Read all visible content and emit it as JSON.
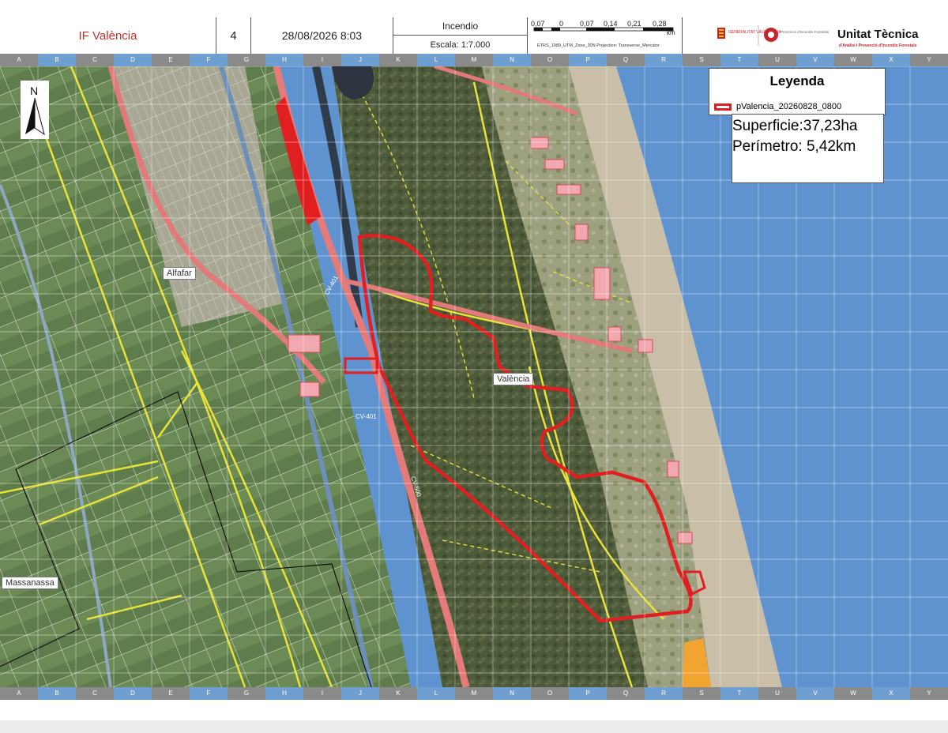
{
  "header": {
    "title": "IF València",
    "sheet_number": "4",
    "datetime": "28/08/2026 8:03",
    "type_label": "Incendio",
    "scale_label": "Escala: 1:7.000",
    "scalebar_ticks": [
      "0,07",
      "0",
      "0,07",
      "0,14",
      "0,21",
      "0,28"
    ],
    "scalebar_unit": "km",
    "projection": "ETRS_1989_UTM_Zone_30N Projection: Transverse_Mercator",
    "logo_gva": "GENERALITAT VALENCIANA",
    "logo_agency": "Prevenció d'Incendis Forestals",
    "unit_name": "Unitat Tècnica",
    "unit_sub": "d'Anàlisi i Prevenció d'Incendis Forestals"
  },
  "grid": {
    "columns": [
      "A",
      "B",
      "C",
      "D",
      "E",
      "F",
      "G",
      "H",
      "I",
      "J",
      "K",
      "L",
      "M",
      "N",
      "O",
      "P",
      "Q",
      "R",
      "S",
      "T",
      "U",
      "V",
      "W",
      "X",
      "Y"
    ],
    "highlight_color": "#6f9fd0",
    "plain_color": "#8a8a8a"
  },
  "legend": {
    "title": "Leyenda",
    "layer_name": "pValencia_20260828_0800",
    "surface": "Superficie:37,23ha",
    "perimeter": "Perímetro: 5,42km"
  },
  "places": {
    "alfafar": "Alfafar",
    "valencia": "València",
    "massanassa": "Massanassa"
  },
  "roads": {
    "cv401": "CV-401",
    "cv500": "CV-500"
  },
  "north": "N",
  "colors": {
    "fire_perimeter": "#e02020",
    "roads": "#e8e23a",
    "sea": "#5f93cf",
    "sand": "#cdc4b0",
    "forest": "#4d5d3a",
    "fields": "#5c7a4a"
  }
}
